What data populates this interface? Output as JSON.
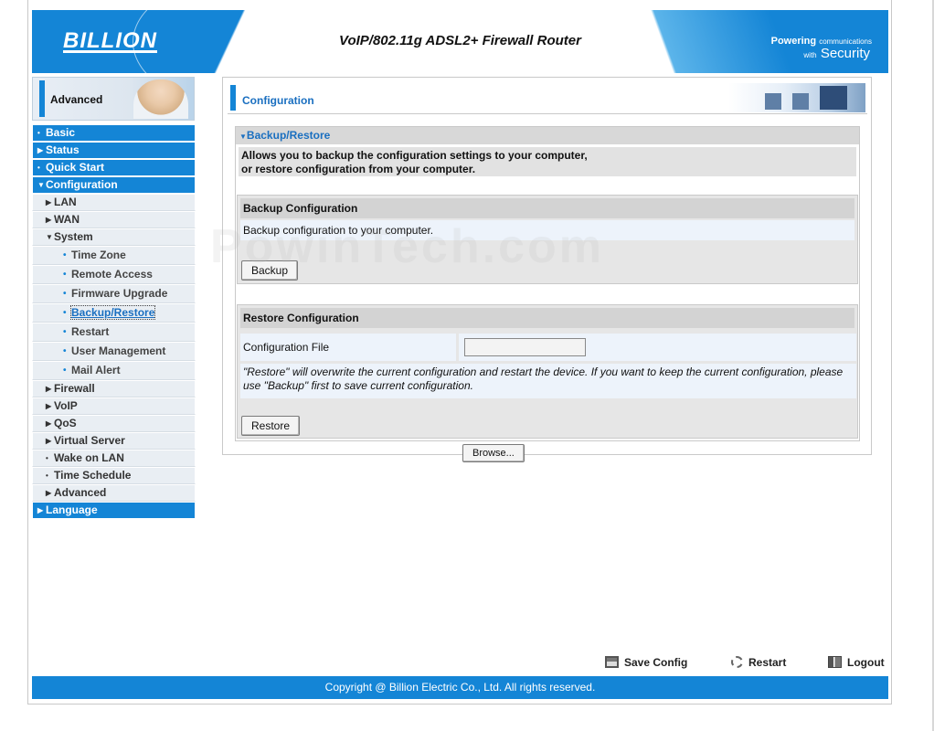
{
  "header": {
    "logo": "BILLION",
    "title": "VoIP/802.11g ADSL2+ Firewall Router",
    "tagline_a": "Powering",
    "tagline_b": "communications",
    "tagline_c": "with",
    "tagline_d": "Security"
  },
  "banner": {
    "label": "Advanced"
  },
  "sidebar": {
    "items": [
      {
        "label": "Basic",
        "level": 1,
        "icon": "bullet-icon"
      },
      {
        "label": "Status",
        "level": 1,
        "icon": "arrow-right-icon"
      },
      {
        "label": "Quick Start",
        "level": 1,
        "icon": "bullet-icon"
      },
      {
        "label": "Configuration",
        "level": 1,
        "icon": "arrow-down-icon"
      },
      {
        "label": "LAN",
        "level": 2,
        "icon": "arrow-right-icon"
      },
      {
        "label": "WAN",
        "level": 2,
        "icon": "arrow-right-icon"
      },
      {
        "label": "System",
        "level": 2,
        "icon": "arrow-down-icon"
      },
      {
        "label": "Time Zone",
        "level": 3,
        "icon": "bullet-icon"
      },
      {
        "label": "Remote Access",
        "level": 3,
        "icon": "bullet-icon"
      },
      {
        "label": "Firmware Upgrade",
        "level": 3,
        "icon": "bullet-icon"
      },
      {
        "label": "Backup/Restore",
        "level": 3,
        "icon": "bullet-icon",
        "active": true
      },
      {
        "label": "Restart",
        "level": 3,
        "icon": "bullet-icon"
      },
      {
        "label": "User Management",
        "level": 3,
        "icon": "bullet-icon"
      },
      {
        "label": "Mail Alert",
        "level": 3,
        "icon": "bullet-icon"
      },
      {
        "label": "Firewall",
        "level": 2,
        "icon": "arrow-right-icon"
      },
      {
        "label": "VoIP",
        "level": 2,
        "icon": "arrow-right-icon"
      },
      {
        "label": "QoS",
        "level": 2,
        "icon": "arrow-right-icon"
      },
      {
        "label": "Virtual Server",
        "level": 2,
        "icon": "arrow-right-icon"
      },
      {
        "label": "Wake on LAN",
        "level": 2,
        "icon": "bullet-icon"
      },
      {
        "label": "Time Schedule",
        "level": 2,
        "icon": "bullet-icon"
      },
      {
        "label": "Advanced",
        "level": 2,
        "icon": "arrow-right-icon"
      },
      {
        "label": "Language",
        "level": 1,
        "icon": "arrow-right-icon"
      }
    ]
  },
  "main": {
    "heading": "Configuration",
    "section_title": "Backup/Restore",
    "description_line1": "Allows you to backup the configuration settings to your computer,",
    "description_line2": "or restore configuration from your computer.",
    "backup": {
      "title": "Backup Configuration",
      "text": "Backup configuration to your computer.",
      "button": "Backup"
    },
    "restore": {
      "title": "Restore Configuration",
      "file_label": "Configuration File",
      "file_value": "",
      "browse_button": "Browse...",
      "note": "\"Restore\" will overwrite the current configuration and restart the device. If you want to keep the current configuration, please use \"Backup\" first to save current configuration.",
      "button": "Restore"
    }
  },
  "watermark": "PowinTech.com",
  "footer_actions": {
    "save": "Save Config",
    "restart": "Restart",
    "logout": "Logout"
  },
  "footer": {
    "copyright": "Copyright @ Billion Electric Co., Ltd. All rights reserved."
  },
  "colors": {
    "accent": "#1485d6",
    "link": "#1a6fc0",
    "panel": "#e6e6e6"
  }
}
